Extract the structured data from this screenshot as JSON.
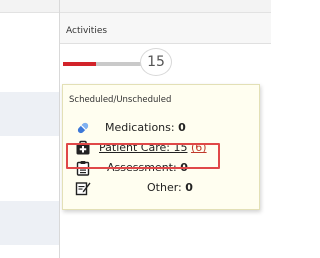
{
  "column": {
    "header": "Activities"
  },
  "activity": {
    "count": "15",
    "progress_fraction": 0.42,
    "bar_fill_color": "#d2232a",
    "bar_track_color": "#c9c9c9"
  },
  "popup": {
    "title": "Scheduled/Unscheduled",
    "rows": [
      {
        "icon": "pill-icon",
        "label": "Medications:",
        "value": "0"
      },
      {
        "icon": "medical-bag-icon",
        "label": "Patient Care:",
        "value": "15",
        "unscheduled": "(6)"
      },
      {
        "icon": "clipboard-icon",
        "label": "Assessment:",
        "value": "0"
      },
      {
        "icon": "edit-note-icon",
        "label": "Other:",
        "value": "0"
      }
    ]
  },
  "colors": {
    "popup_background": "#fffef0",
    "highlight_border": "#e04848",
    "unscheduled_text": "#c0392b",
    "pill_icon": "#3c78d8"
  }
}
